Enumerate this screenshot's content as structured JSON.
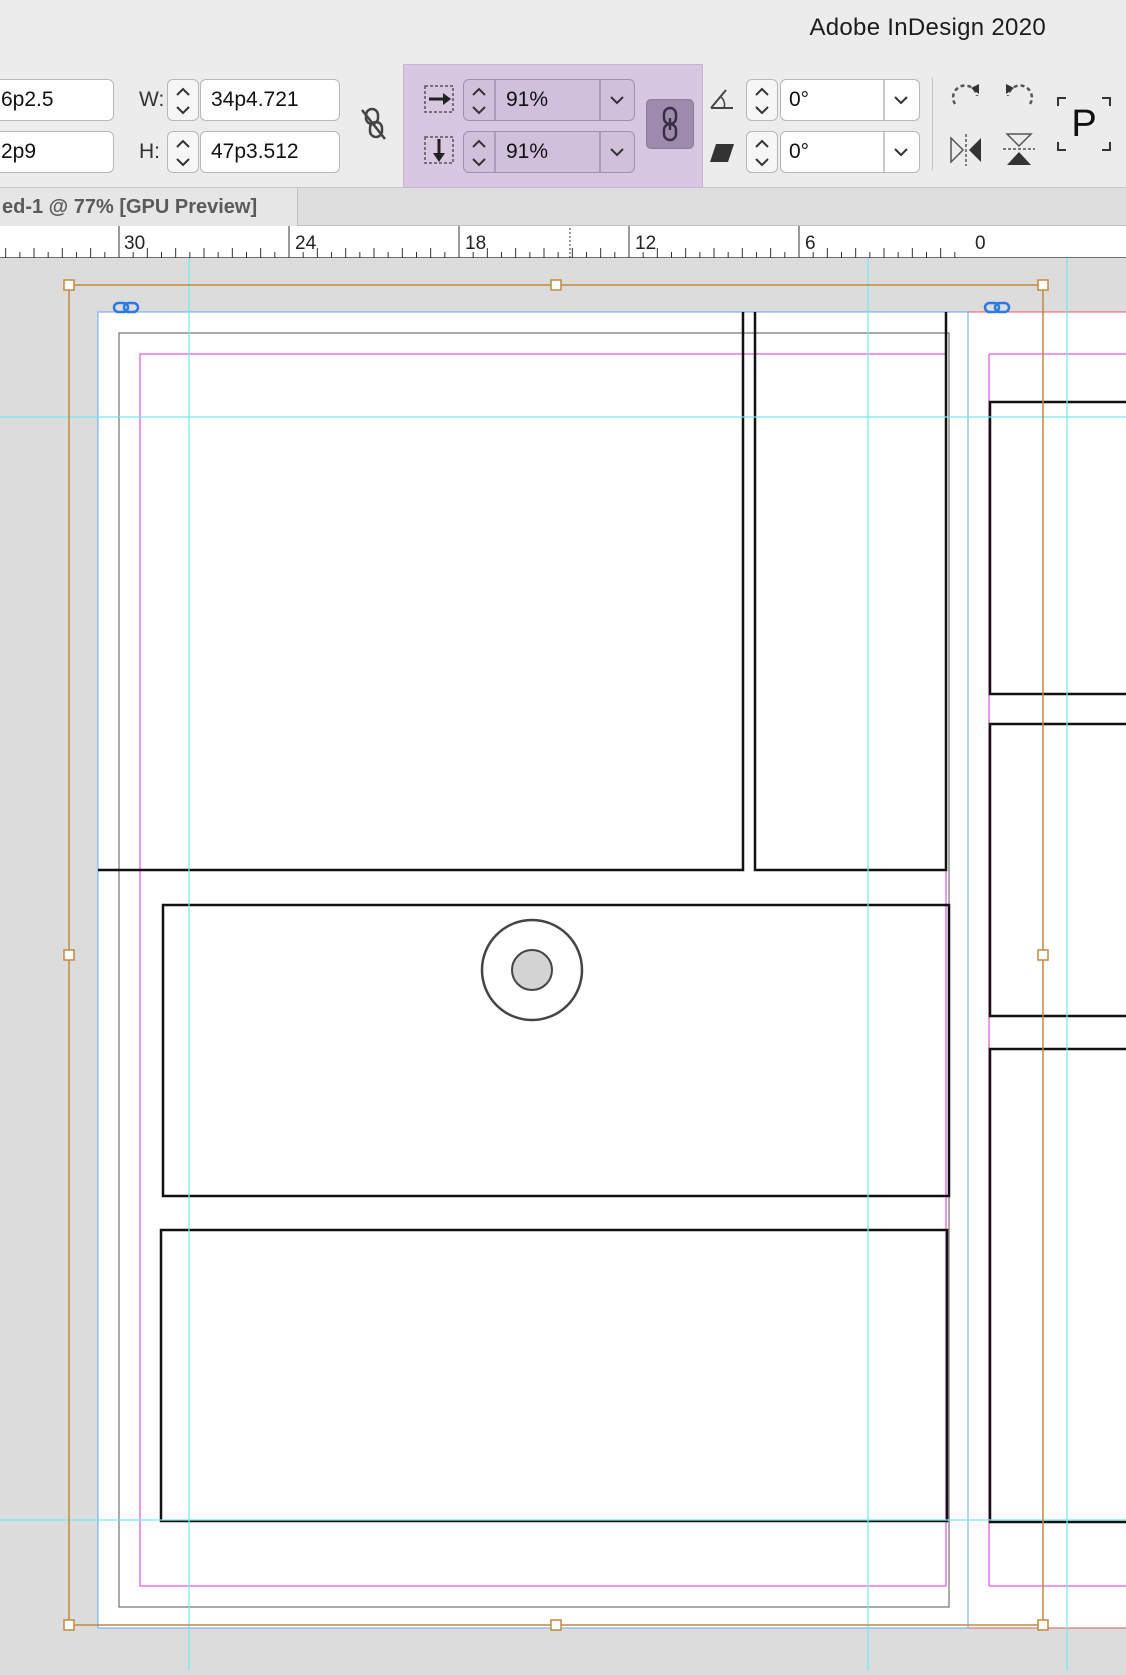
{
  "app": {
    "title": "Adobe InDesign 2020"
  },
  "control_panel": {
    "x_value": "6p2.5",
    "y_value": "2p9",
    "w_label": "W:",
    "w_value": "34p4.721",
    "h_label": "H:",
    "h_value": "47p3.512",
    "scale_x_value": "91%",
    "scale_y_value": "91%",
    "rotation_value": "0°",
    "shear_value": "0°",
    "type_icon_glyph": "P"
  },
  "document": {
    "tab_label": "ed-1 @ 77% [GPU Preview]"
  },
  "ruler": {
    "labels": [
      "30",
      "24",
      "18",
      "12",
      "6",
      "0"
    ]
  },
  "colors": {
    "selection": "#c08a3e",
    "page_edge": "#6aa6f5",
    "margin": "#e277e9",
    "guide": "#70eaf0",
    "frame": "#111111",
    "bleed": "#e45a5a"
  },
  "icons": [
    "constrain-unlinked-icon",
    "scale-x-icon",
    "scale-y-icon",
    "constrain-scale-link-icon",
    "rotate-angle-icon",
    "shear-icon",
    "rotate-clockwise-icon",
    "rotate-counterclockwise-icon",
    "flip-horizontal-icon",
    "flip-vertical-icon",
    "type-on-path-icon",
    "frame-link-icon"
  ]
}
